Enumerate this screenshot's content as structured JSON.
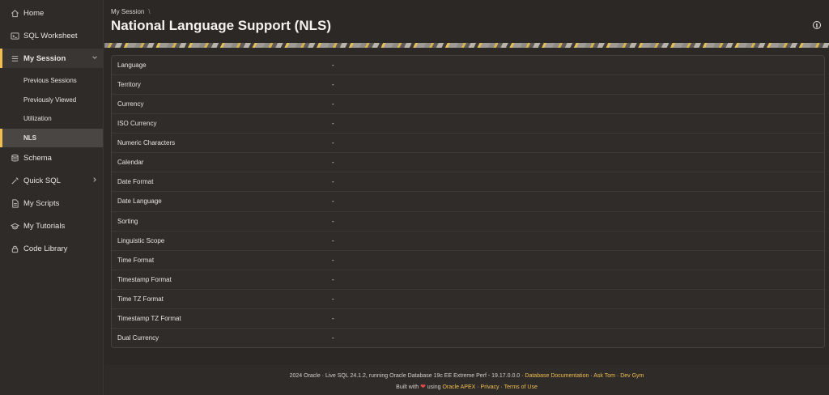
{
  "sidebar": {
    "items": [
      {
        "label": "Home",
        "icon": "home-icon"
      },
      {
        "label": "SQL Worksheet",
        "icon": "terminal-icon"
      },
      {
        "label": "My Session",
        "icon": "menu-icon",
        "expanded": true
      },
      {
        "label": "Schema",
        "icon": "database-icon"
      },
      {
        "label": "Quick SQL",
        "icon": "wand-icon"
      },
      {
        "label": "My Scripts",
        "icon": "file-icon"
      },
      {
        "label": "My Tutorials",
        "icon": "graduation-cap-icon"
      },
      {
        "label": "Code Library",
        "icon": "lock-icon"
      }
    ],
    "session_sub": [
      "Previous Sessions",
      "Previously Viewed",
      "Utilization",
      "NLS"
    ]
  },
  "header": {
    "breadcrumb": "My Session",
    "breadcrumb_sep": "\\",
    "title": "National Language Support (NLS)",
    "info_glyph": "i"
  },
  "nls": {
    "rows": [
      {
        "label": "Language",
        "value": "-"
      },
      {
        "label": "Territory",
        "value": "-"
      },
      {
        "label": "Currency",
        "value": "-"
      },
      {
        "label": "ISO Currency",
        "value": "-"
      },
      {
        "label": "Numeric Characters",
        "value": "-"
      },
      {
        "label": "Calendar",
        "value": "-"
      },
      {
        "label": "Date Format",
        "value": "-"
      },
      {
        "label": "Date Language",
        "value": "-"
      },
      {
        "label": "Sorting",
        "value": "-"
      },
      {
        "label": "Linguistic Scope",
        "value": "-"
      },
      {
        "label": "Time Format",
        "value": "-"
      },
      {
        "label": "Timestamp Format",
        "value": "-"
      },
      {
        "label": "Time TZ Format",
        "value": "-"
      },
      {
        "label": "Timestamp TZ Format",
        "value": "-"
      },
      {
        "label": "Dual Currency",
        "value": "-"
      }
    ]
  },
  "footer": {
    "line1_text": "2024 Oracle · Live SQL 24.1.2, running Oracle Database 19c EE Extreme Perf - 19.17.0.0.0 · ",
    "doc_link": "Database Documentation",
    "sep": " · ",
    "asktom_link": "Ask Tom",
    "devgym_link": "Dev Gym",
    "built_with": "Built with ",
    "heart": "❤",
    "using": " using ",
    "apex_link": "Oracle APEX",
    "privacy_link": "Privacy",
    "terms_link": "Terms of Use"
  },
  "colors": {
    "accent": "#f1bf4f",
    "background": "#2b2826",
    "panel": "#2f2c2a"
  }
}
